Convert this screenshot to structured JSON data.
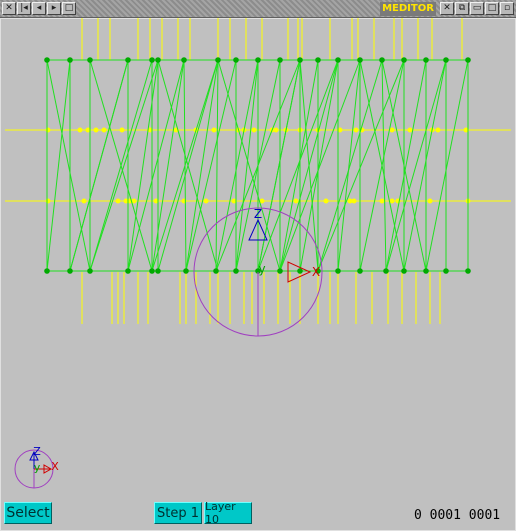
{
  "window": {
    "title": "MEDITOR",
    "left_buttons": [
      "close-icon",
      "first-icon",
      "prev-icon",
      "next-icon",
      "last-icon"
    ],
    "right_buttons": [
      "x-close-icon",
      "shade-icon",
      "minimize-icon",
      "maximize-icon"
    ]
  },
  "scene": {
    "axis_labels": {
      "z": "Z",
      "y": "y",
      "x": "X"
    },
    "mini_axis_labels": {
      "z": "Z",
      "y": "y",
      "x": "X"
    },
    "colors": {
      "mesh": "#20e020",
      "node": "#00aa00",
      "yellow": "#ffff00",
      "gizmo": "#a040c0",
      "z": "#0000c0",
      "x": "#d00000",
      "y": "#00a000"
    }
  },
  "toolbar": {
    "select_label": "Select",
    "step_label": "Step 1",
    "layer_label": "Layer 10"
  },
  "status": {
    "counter_a": "0",
    "counter_b": "0001",
    "counter_c": "0001"
  }
}
